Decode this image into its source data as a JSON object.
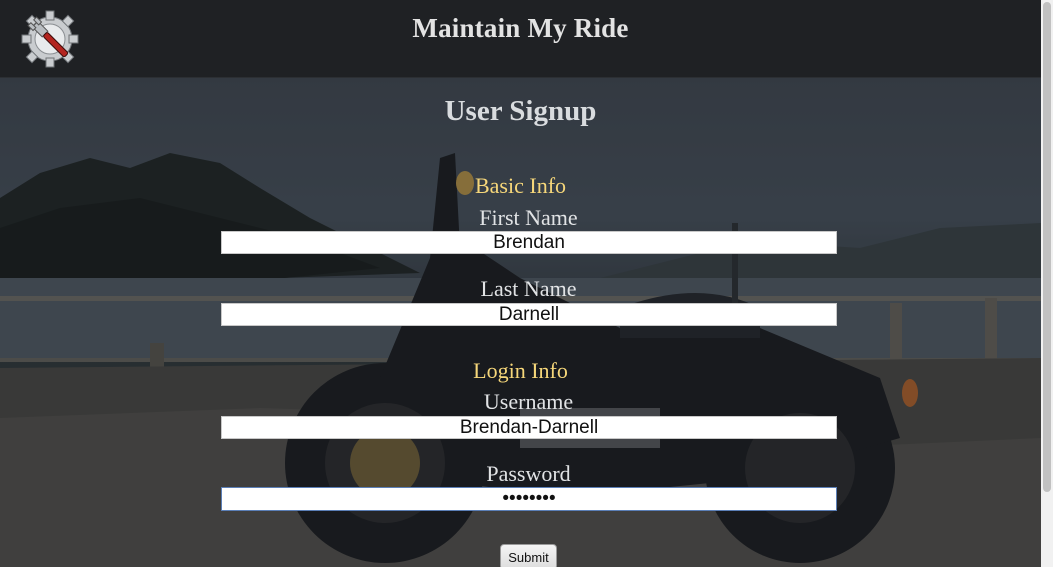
{
  "header": {
    "app_title": "Maintain My Ride",
    "logo_icon": "wrench-gear-icon"
  },
  "signup": {
    "title": "User Signup",
    "basic_info_heading": "Basic Info",
    "first_name_label": "First Name",
    "first_name_value": "Brendan",
    "last_name_label": "Last Name",
    "last_name_value": "Darnell",
    "login_info_heading": "Login Info",
    "username_label": "Username",
    "username_value": "Brendan-Darnell",
    "password_label": "Password",
    "password_value": "••••••••",
    "submit_label": "Submit"
  },
  "colors": {
    "header_bg": "#1f2124",
    "section_heading": "#f6d77a",
    "label_text": "#e1e3e5"
  }
}
